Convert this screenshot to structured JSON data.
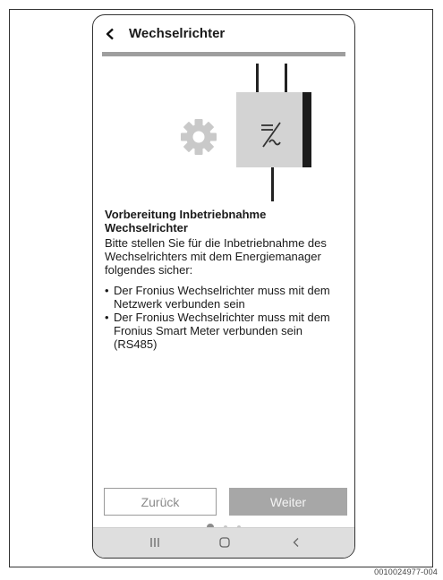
{
  "header": {
    "title": "Wechselrichter"
  },
  "content": {
    "heading": "Vorbereitung Inbetriebnahme Wechselrichter",
    "intro": "Bitte stellen Sie für die Inbetriebnahme des Wechselrichters mit dem Energiemanager folgendes sicher:",
    "bullets": [
      "Der Fronius Wechselrichter muss mit dem Netzwerk verbunden sein",
      "Der Fronius Wechselrichter muss mit dem Fronius Smart Meter verbunden sein (RS485)"
    ]
  },
  "buttons": {
    "back_label": "Zurück",
    "next_label": "Weiter"
  },
  "pager": {
    "page": 1,
    "pages": 3
  },
  "icons": [
    "back-arrow-icon",
    "gear-icon",
    "inverter-icon",
    "recent-apps-icon",
    "home-icon",
    "system-back-icon"
  ],
  "colors": {
    "accent_bar": "#9e9e9e",
    "next_button": "#a7a7a7",
    "navbar": "#dedede"
  },
  "doc_id": "0010024977-004"
}
